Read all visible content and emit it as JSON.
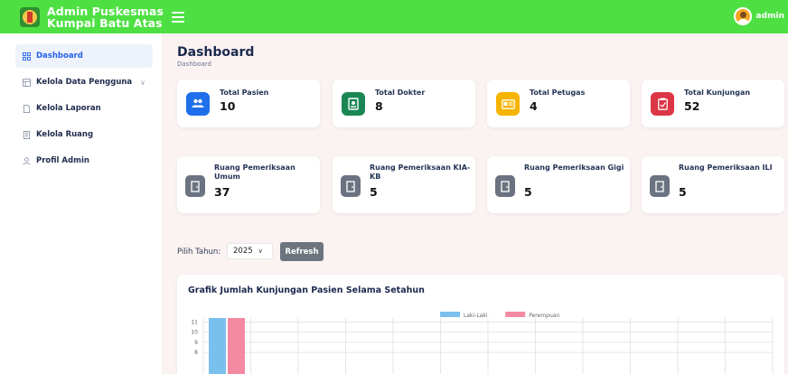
{
  "app": {
    "title_line1": "Admin Puskesmas",
    "title_line2": "Kumpai Batu Atas",
    "user_name": "admin"
  },
  "sidebar": {
    "items": [
      {
        "label": "Dashboard",
        "icon": "grid-icon",
        "active": true
      },
      {
        "label": "Kelola Data Pengguna",
        "icon": "layout-icon",
        "has_submenu": true
      },
      {
        "label": "Kelola Laporan",
        "icon": "file-icon"
      },
      {
        "label": "Kelola Ruang",
        "icon": "building-icon"
      },
      {
        "label": "Profil Admin",
        "icon": "person-icon"
      }
    ]
  },
  "page": {
    "title": "Dashboard",
    "breadcrumb": "Dashboard"
  },
  "stats": [
    {
      "label": "Total Pasien",
      "value": "10",
      "color": "#1f6feb",
      "icon": "people-icon"
    },
    {
      "label": "Total Dokter",
      "value": "8",
      "color": "#198754",
      "icon": "doctor-badge-icon"
    },
    {
      "label": "Total Petugas",
      "value": "4",
      "color": "#f5b400",
      "icon": "id-card-icon"
    },
    {
      "label": "Total Kunjungan",
      "value": "52",
      "color": "#dc3545",
      "icon": "clipboard-icon"
    }
  ],
  "rooms": [
    {
      "label": "Ruang Pemeriksaan Umum",
      "value": "37",
      "icon": "door-icon"
    },
    {
      "label": "Ruang Pemeriksaan KIA-KB",
      "value": "5",
      "icon": "door-icon"
    },
    {
      "label": "Ruang Pemeriksaan Gigi",
      "value": "5",
      "icon": "door-icon"
    },
    {
      "label": "Ruang Pemeriksaan ILI",
      "value": "5",
      "icon": "door-icon"
    }
  ],
  "filter": {
    "label": "Pilih Tahun:",
    "selected_year": "2025",
    "refresh_label": "Refresh"
  },
  "chart_data": {
    "type": "bar",
    "title": "Grafik Jumlah Kunjungan Pasien Selama Setahun",
    "y_ticks": [
      8,
      9,
      10,
      11
    ],
    "ylim_visible": [
      7.6,
      11.4
    ],
    "num_categories": 12,
    "series": [
      {
        "name": "Laki-Laki",
        "color": "#7ac0ec",
        "values_visible": [
          ">=11"
        ]
      },
      {
        "name": "Perempuan",
        "color": "#f48aa2",
        "values_visible": [
          ">=11"
        ]
      }
    ],
    "legend_position": "top-center",
    "grid": true
  }
}
